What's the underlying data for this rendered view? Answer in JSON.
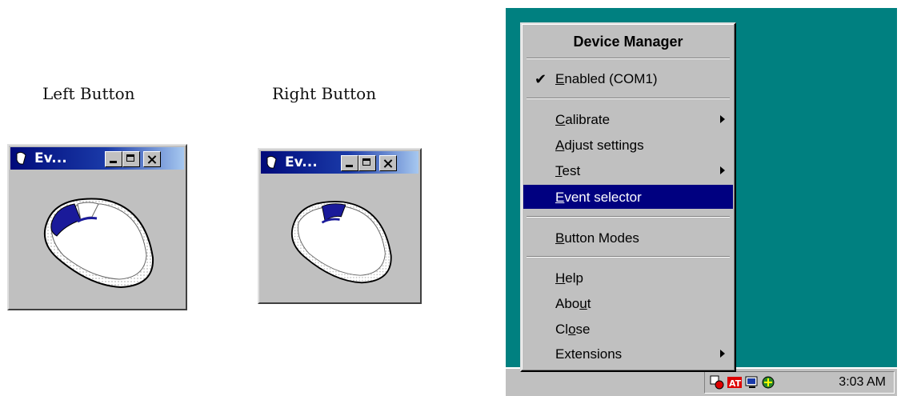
{
  "captions": {
    "left": "Left Button",
    "right": "Right Button"
  },
  "left_window": {
    "title": "Ev...",
    "highlighted_button": "left"
  },
  "right_window": {
    "title": "Ev...",
    "highlighted_button": "right"
  },
  "menu": {
    "title": "Device Manager",
    "enabled": {
      "pre": "",
      "ul": "E",
      "post": "nabled (COM1)",
      "checked": true
    },
    "calibrate": {
      "pre": "",
      "ul": "C",
      "post": "alibrate",
      "submenu": true
    },
    "adjust": {
      "pre": "",
      "ul": "A",
      "post": "djust settings"
    },
    "test": {
      "pre": "",
      "ul": "T",
      "post": "est",
      "submenu": true
    },
    "event": {
      "pre": "",
      "ul": "E",
      "post": "vent selector",
      "selected": true
    },
    "button_modes": {
      "pre": "",
      "ul": "B",
      "post": "utton Modes"
    },
    "help": {
      "pre": "",
      "ul": "H",
      "post": "elp"
    },
    "about": {
      "pre": "Abo",
      "ul": "u",
      "post": "t"
    },
    "close": {
      "pre": "Cl",
      "ul": "o",
      "post": "se"
    },
    "extensions": {
      "pre": "Extensions",
      "ul": "",
      "post": "",
      "submenu": true
    }
  },
  "taskbar": {
    "clock": "3:03 AM",
    "tray_icons": [
      "device-manager-icon",
      "ati-icon",
      "display-icon",
      "network-icon"
    ]
  },
  "colors": {
    "desktop": "#008080",
    "highlight": "#000080",
    "face": "#c0c0c0"
  }
}
